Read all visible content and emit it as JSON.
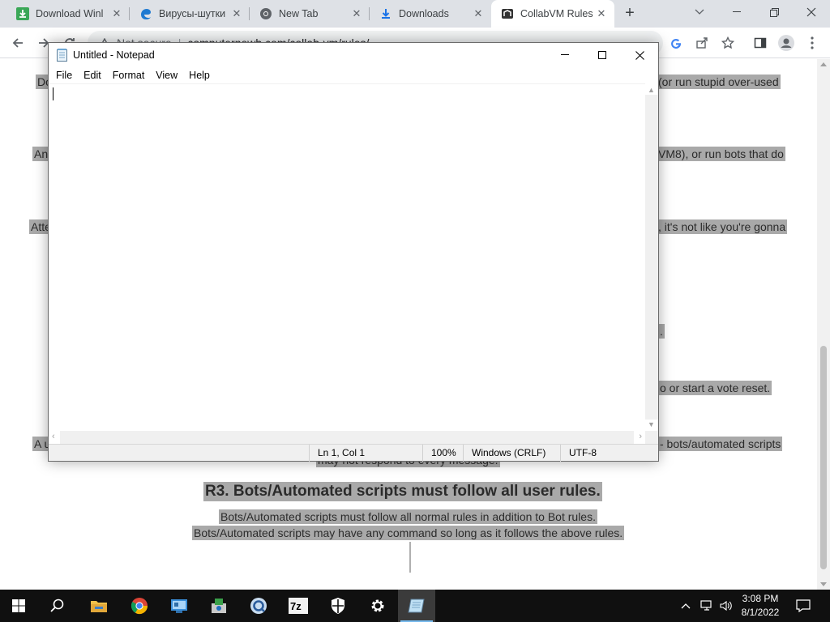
{
  "browser": {
    "tabs": [
      {
        "title": "Download Winl",
        "icon": "download-arrow-icon",
        "active": false
      },
      {
        "title": "Вирусы-шутки",
        "icon": "edge-icon",
        "active": false
      },
      {
        "title": "New Tab",
        "icon": "chrome-icon",
        "active": false
      },
      {
        "title": "Downloads",
        "icon": "download-icon",
        "active": false
      },
      {
        "title": "CollabVM Rules",
        "icon": "collabvm-icon",
        "active": true
      }
    ],
    "address": {
      "security": "Not secure",
      "url": "computernewb.com/collab-vm/rules/"
    }
  },
  "page": {
    "lines": [
      "Do",
      "(or run stupid over-used",
      "An",
      "VM8), or run bots that do",
      "Atte",
      ", it's not like you're gonna",
      ".",
      "o or start a vote reset.",
      "A u",
      "- bots/automated scripts",
      "may not respond to every message."
    ],
    "heading": "R3. Bots/Automated scripts must follow all user rules.",
    "paragraph": [
      "Bots/Automated scripts must follow all normal rules in addition to Bot rules.",
      "Bots/Automated scripts may have any command so long as it follows the above rules."
    ]
  },
  "notepad": {
    "title": "Untitled - Notepad",
    "menu": [
      "File",
      "Edit",
      "Format",
      "View",
      "Help"
    ],
    "status": {
      "position": "Ln 1, Col 1",
      "zoom": "100%",
      "line_ending": "Windows (CRLF)",
      "encoding": "UTF-8"
    }
  },
  "taskbar": {
    "items": [
      "start-icon",
      "search-icon",
      "file-explorer-icon",
      "chrome-icon",
      "control-panel-icon",
      "installer-icon",
      "qbittorrent-icon",
      "7zip-icon",
      "windows-security-icon",
      "settings-icon",
      "notepad-icon"
    ],
    "clock": {
      "time": "3:08 PM",
      "date": "8/1/2022"
    }
  }
}
